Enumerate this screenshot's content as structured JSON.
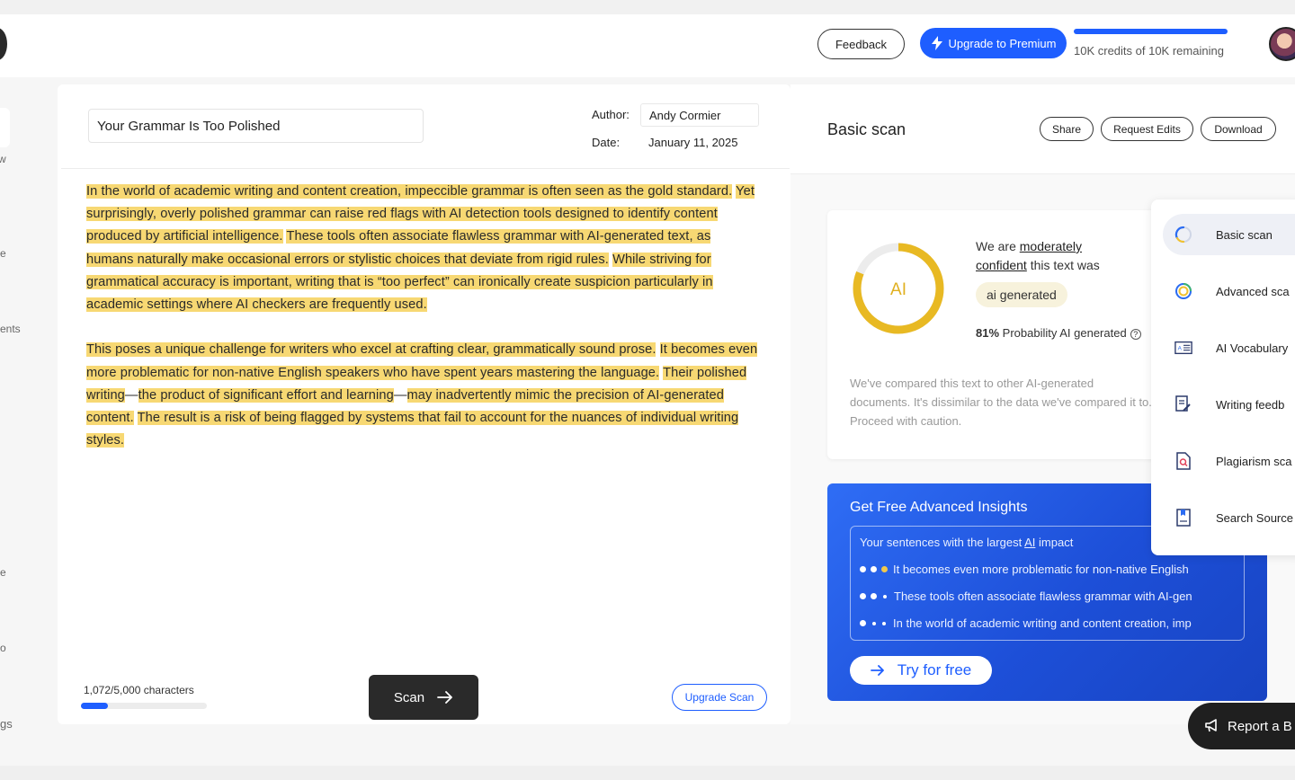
{
  "header": {
    "feedback_label": "Feedback",
    "upgrade_label": "Upgrade to Premium",
    "credits_text": "10K credits of 10K remaining",
    "credits_fraction": 1.0
  },
  "sidebar": {
    "partial_labels": [
      "w",
      "e",
      "ents",
      "e",
      "o",
      "gs"
    ]
  },
  "editor": {
    "title": "Your Grammar Is Too Polished",
    "author_label": "Author:",
    "author_value": "Andy Cormier",
    "date_label": "Date:",
    "date_value": "January 11, 2025",
    "paragraphs": [
      [
        "In the world of academic writing and content creation, impeccible grammar is often seen as the gold standard.",
        "Yet surprisingly, overly polished grammar can raise red flags with AI detection tools designed to identify content produced by artificial intelligence.",
        "These tools often associate flawless grammar with AI-generated text, as humans naturally make occasional errors or stylistic choices that deviate from rigid rules.",
        "While striving for grammatical accuracy is important, writing that is “too perfect” can ironically create suspicion particularly in academic settings where AI checkers are frequently used."
      ],
      [
        "This poses a unique challenge for writers who excel at crafting clear, grammatically sound prose.",
        "It becomes even more problematic for non-native English speakers who have spent years mastering the language.",
        "Their polished writing",
        "—",
        "the product of significant effort and learning",
        "—",
        "may inadvertently mimic the precision of AI-generated content.",
        "The result is a risk of being flagged by systems that fail to account for the nuances of individual writing styles."
      ]
    ],
    "char_count": "1,072/5,000 characters",
    "char_fraction": 0.2144,
    "scan_label": "Scan",
    "upgrade_scan_label": "Upgrade Scan"
  },
  "results": {
    "title": "Basic scan",
    "share_label": "Share",
    "request_edits_label": "Request Edits",
    "download_label": "Download",
    "gauge_label": "AI",
    "gauge_fraction": 0.81,
    "confidence_prefix": "We are",
    "confidence_word1": "moderately",
    "confidence_word2": "confident",
    "confidence_suffix": "this text was",
    "badge": "ai generated",
    "probability_value": "81%",
    "probability_text": "Probability AI generated",
    "compare_text": "We've compared this text to other AI-generated documents. It's dissimilar to the data we've compared it to. Proceed with caution.",
    "accent_color": "#e8b923"
  },
  "insights": {
    "title": "Get Free Advanced Insights",
    "box_title_prefix": "Your sentences with the largest",
    "box_title_ai": "AI",
    "box_title_suffix": "impact",
    "rows": [
      "It becomes even more problematic for non-native English",
      "These tools often associate flawless grammar with AI-gen",
      "In the world of academic writing and content creation, imp"
    ],
    "try_label": "Try for free"
  },
  "scan_menu": {
    "items": [
      {
        "label": "Basic scan",
        "icon": "basic-scan-icon"
      },
      {
        "label": "Advanced sca",
        "icon": "advanced-scan-icon"
      },
      {
        "label": "AI Vocabulary",
        "icon": "ai-vocabulary-icon"
      },
      {
        "label": "Writing feedb",
        "icon": "writing-feedback-icon"
      },
      {
        "label": "Plagiarism sca",
        "icon": "plagiarism-scan-icon"
      },
      {
        "label": "Search Source",
        "icon": "search-sources-icon"
      }
    ]
  },
  "report": {
    "label": "Report a B"
  }
}
